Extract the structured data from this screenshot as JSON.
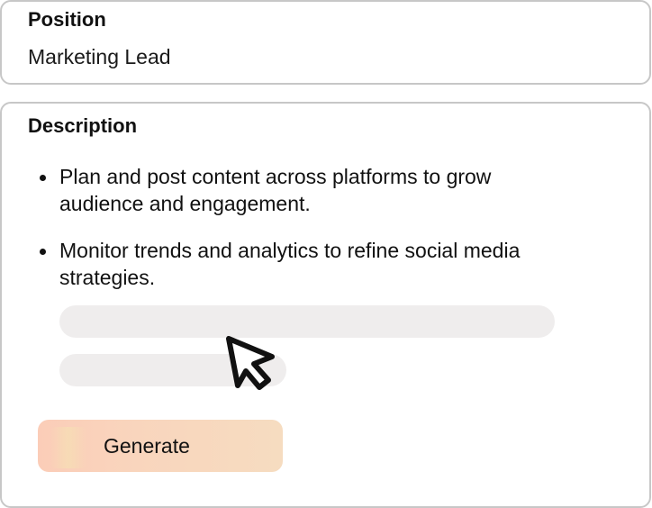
{
  "position": {
    "label": "Position",
    "value": "Marketing Lead"
  },
  "description": {
    "label": "Description",
    "bullets": [
      "Plan and post content across platforms to grow audience and engagement.",
      "Monitor trends and analytics to refine social media strategies."
    ],
    "placeholder_lines": 2
  },
  "actions": {
    "generate_label": "Generate"
  },
  "colors": {
    "border": "#c7c7c7",
    "skeleton": "#efeded",
    "button_gradient_start": "#fbcdb8",
    "button_gradient_end": "#f6dcc0",
    "text": "#111111"
  },
  "icons": {
    "cursor": "mouse-pointer-icon"
  }
}
